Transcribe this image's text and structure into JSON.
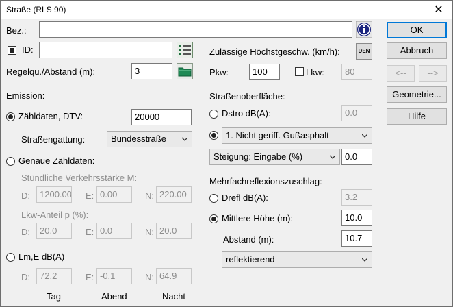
{
  "window": {
    "title": "Straße (RLS 90)",
    "close": "✕"
  },
  "bez": {
    "label": "Bez.:",
    "value": ""
  },
  "id": {
    "label": "ID:",
    "value": "",
    "checked": true
  },
  "regelqu": {
    "label": "Regelqu./Abstand (m):",
    "value": "3"
  },
  "emission": {
    "label": "Emission:"
  },
  "zaehldaten": {
    "label": "Zähldaten, DTV:",
    "value": "20000",
    "selected": true
  },
  "strassengattung": {
    "label": "Straßengattung:",
    "value": "Bundesstraße"
  },
  "genaue": {
    "label": "Genaue Zähldaten:",
    "stuendliche_label": "Stündliche Verkehrsstärke M:",
    "m": {
      "d_label": "D:",
      "d": "1200.00",
      "e_label": "E:",
      "e": "0.00",
      "n_label": "N:",
      "n": "220.00"
    },
    "lkw_anteil_label": "Lkw-Anteil p (%):",
    "p": {
      "d_label": "D:",
      "d": "20.0",
      "e_label": "E:",
      "e": "0.0",
      "n_label": "N:",
      "n": "20.0"
    }
  },
  "lme": {
    "label": "Lm,E dB(A)",
    "d_label": "D:",
    "d": "72.2",
    "e_label": "E:",
    "e": "-0.1",
    "n_label": "N:",
    "n": "64.9"
  },
  "periods": {
    "tag": "Tag",
    "abend": "Abend",
    "nacht": "Nacht"
  },
  "speed": {
    "label": "Zulässige Höchstgeschw. (km/h):",
    "den_icon_text": "DEN",
    "pkw_label": "Pkw:",
    "pkw": "100",
    "lkw_label": "Lkw:",
    "lkw": "80",
    "lkw_checked": false
  },
  "surface": {
    "label": "Straßenoberfläche:",
    "dstro_label": "Dstro dB(A):",
    "dstro": "0.0",
    "type": "1. Nicht geriff. Gußasphalt"
  },
  "steigung": {
    "select": "Steigung: Eingabe (%)",
    "value": "0.0"
  },
  "reflection": {
    "label": "Mehrfachreflexionszuschlag:",
    "drefl_label": "Drefl dB(A):",
    "drefl": "3.2",
    "hoehe_label": "Mittlere Höhe (m):",
    "hoehe": "10.0",
    "abstand_label": "Abstand (m):",
    "abstand": "10.7",
    "type": "reflektierend"
  },
  "buttons": {
    "ok": "OK",
    "cancel": "Abbruch",
    "prev": "<--",
    "next": "-->",
    "geometry": "Geometrie...",
    "help": "Hilfe"
  },
  "colors": {
    "info_icon": "#1a237e",
    "folder": "#1f8a55",
    "default_button_border": "#0078d7"
  }
}
